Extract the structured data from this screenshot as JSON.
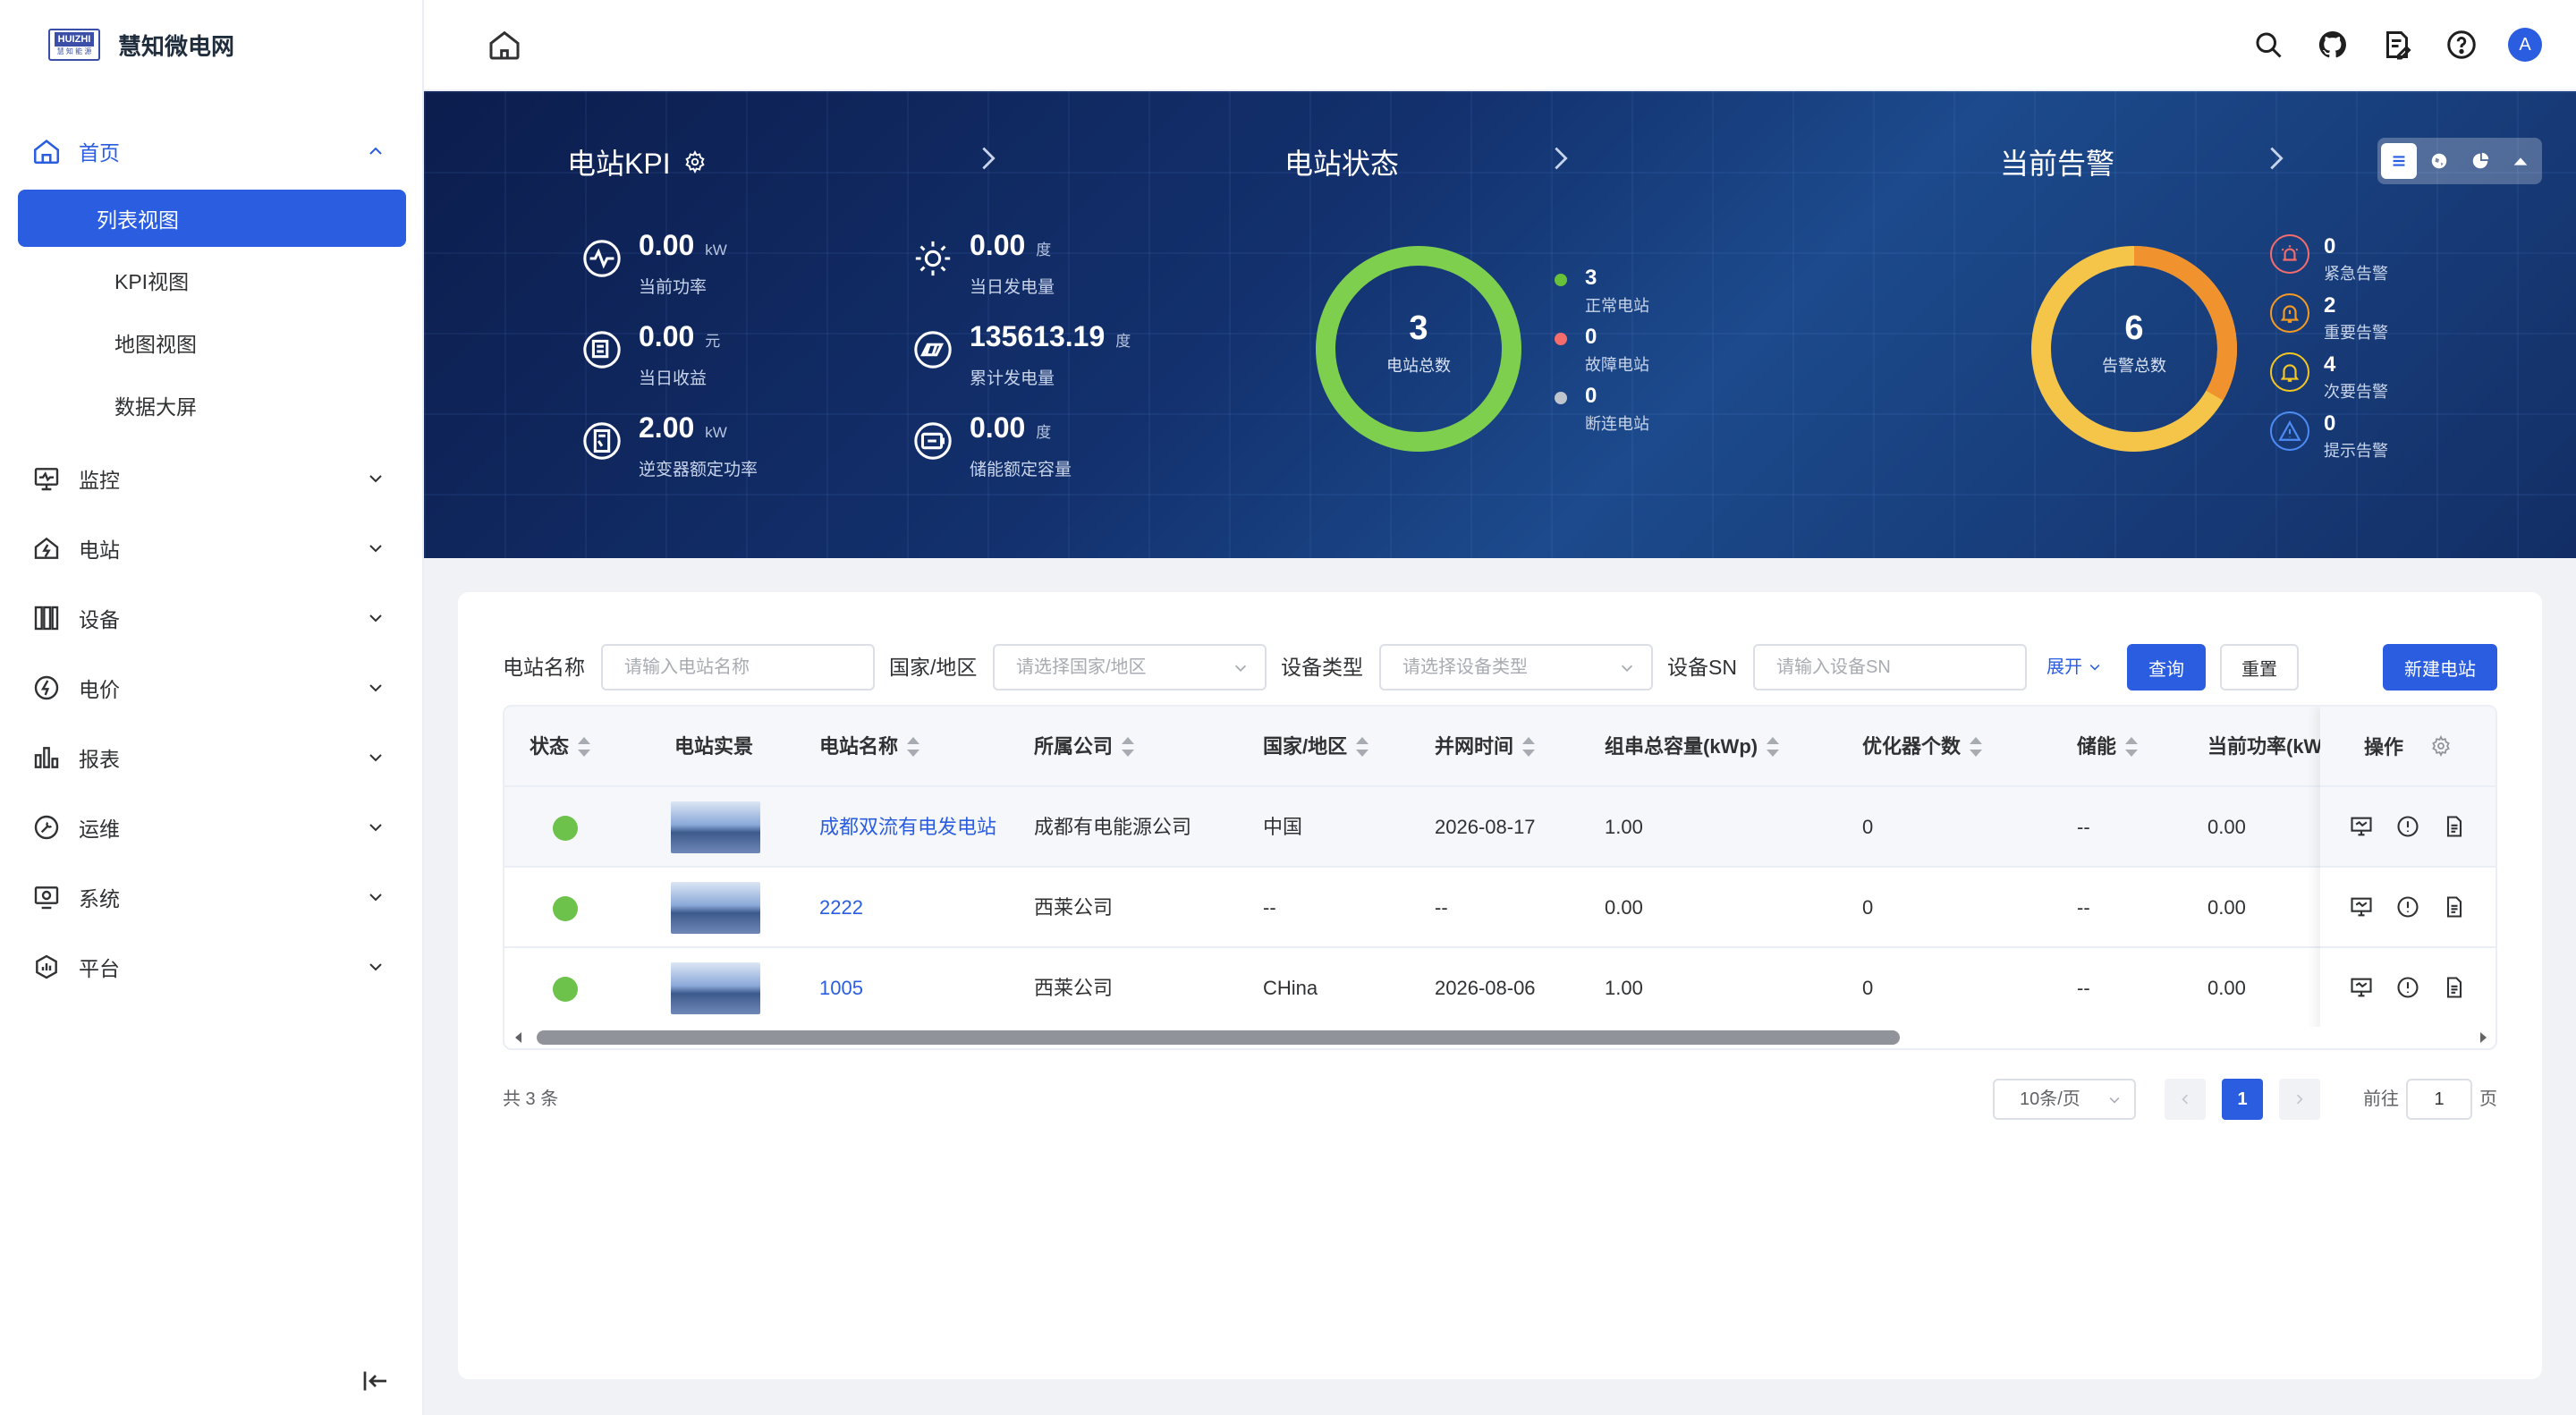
{
  "app": {
    "name": "慧知微电网",
    "logo_line1": "HUIZHI",
    "logo_line2": "慧 知 能 源"
  },
  "sidebar": {
    "home": {
      "label": "首页",
      "children": [
        "列表视图",
        "KPI视图",
        "地图视图",
        "数据大屏"
      ],
      "active_child": 0
    },
    "items": [
      "监控",
      "电站",
      "设备",
      "电价",
      "报表",
      "运维",
      "系统",
      "平台"
    ]
  },
  "kpi_panel": {
    "title": "电站KPI",
    "items": [
      {
        "value": "0.00",
        "unit": "kW",
        "label": "当前功率"
      },
      {
        "value": "0.00",
        "unit": "度",
        "label": "当日发电量"
      },
      {
        "value": "0.00",
        "unit": "元",
        "label": "当日收益"
      },
      {
        "value": "135613.19",
        "unit": "度",
        "label": "累计发电量"
      },
      {
        "value": "2.00",
        "unit": "kW",
        "label": "逆变器额定功率"
      },
      {
        "value": "0.00",
        "unit": "度",
        "label": "储能额定容量"
      }
    ]
  },
  "status_panel": {
    "title": "电站状态",
    "total": "3",
    "total_label": "电站总数",
    "items": [
      {
        "value": "3",
        "label": "正常电站",
        "color": "#67c23a"
      },
      {
        "value": "0",
        "label": "故障电站",
        "color": "#f56c6c"
      },
      {
        "value": "0",
        "label": "断连电站",
        "color": "#c0c4cc"
      }
    ]
  },
  "alarm_panel": {
    "title": "当前告警",
    "total": "6",
    "total_label": "告警总数",
    "items": [
      {
        "value": "0",
        "label": "紧急告警",
        "color": "#f56c6c"
      },
      {
        "value": "2",
        "label": "重要告警",
        "color": "#f59a23"
      },
      {
        "value": "4",
        "label": "次要告警",
        "color": "#f5c623"
      },
      {
        "value": "0",
        "label": "提示告警",
        "color": "#4d8cf5"
      }
    ]
  },
  "filters": {
    "station_name": {
      "label": "电站名称",
      "placeholder": "请输入电站名称"
    },
    "country": {
      "label": "国家/地区",
      "placeholder": "请选择国家/地区"
    },
    "device_type": {
      "label": "设备类型",
      "placeholder": "请选择设备类型"
    },
    "device_sn": {
      "label": "设备SN",
      "placeholder": "请输入设备SN"
    },
    "expand": "展开",
    "query": "查询",
    "reset": "重置",
    "new_station": "新建电站"
  },
  "table": {
    "columns": [
      "状态",
      "电站实景",
      "电站名称",
      "所属公司",
      "国家/地区",
      "并网时间",
      "组串总容量(kWp)",
      "优化器个数",
      "储能",
      "当前功率(kW)",
      "操作"
    ],
    "rows": [
      {
        "name": "成都双流有电发电站",
        "company": "成都有电能源公司",
        "country": "中国",
        "grid_time": "2026-08-17",
        "capacity": "1.00",
        "optimizers": "0",
        "storage": "--",
        "power": "0.00"
      },
      {
        "name": "2222",
        "company": "西莱公司",
        "country": "--",
        "grid_time": "--",
        "capacity": "0.00",
        "optimizers": "0",
        "storage": "--",
        "power": "0.00"
      },
      {
        "name": "1005",
        "company": "西莱公司",
        "country": "CHina",
        "grid_time": "2026-08-06",
        "capacity": "1.00",
        "optimizers": "0",
        "storage": "--",
        "power": "0.00"
      }
    ]
  },
  "pagination": {
    "total": "共 3 条",
    "page_size": "10条/页",
    "current": "1",
    "goto_label": "前往",
    "goto_value": "1",
    "page_suffix": "页"
  },
  "colors": {
    "primary": "#2a5de0",
    "online": "#6cc24a"
  }
}
